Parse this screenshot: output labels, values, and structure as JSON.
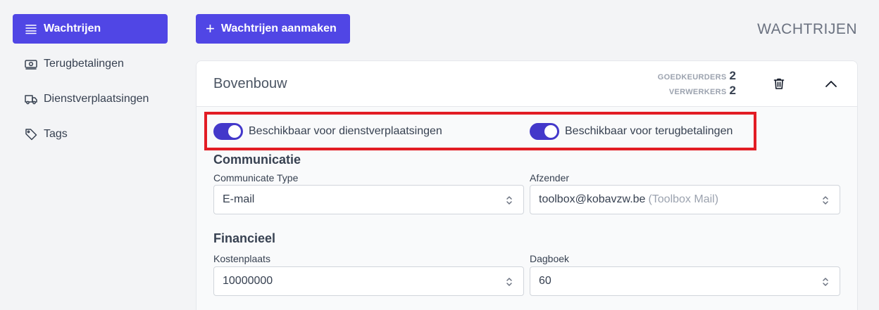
{
  "sidebar": {
    "items": [
      {
        "label": "Wachtrijen",
        "icon": "queue-list-icon",
        "active": true
      },
      {
        "label": "Terugbetalingen",
        "icon": "banknote-icon",
        "active": false
      },
      {
        "label": "Dienstverplaatsingen",
        "icon": "truck-icon",
        "active": false
      },
      {
        "label": "Tags",
        "icon": "tag-icon",
        "active": false
      }
    ]
  },
  "toolbar": {
    "create_label": "Wachtrijen aanmaken",
    "create_icon": "plus-icon",
    "page_title": "WACHTRIJEN"
  },
  "queue": {
    "title": "Bovenbouw",
    "approvers_label": "GOEDKEURDERS",
    "approvers_count": "2",
    "processors_label": "VERWERKERS",
    "processors_count": "2",
    "delete_icon": "trash-icon",
    "collapse_icon": "chevron-up-icon",
    "toggles": {
      "service_moves": {
        "label": "Beschikbaar voor dienstverplaatsingen",
        "on": true
      },
      "refunds": {
        "label": "Beschikbaar voor terugbetalingen",
        "on": true
      }
    },
    "communication": {
      "title": "Communicatie",
      "type_label": "Communicate Type",
      "type_value": "E-mail",
      "sender_label": "Afzender",
      "sender_value": "toolbox@kobavzw.be",
      "sender_hint": "(Toolbox Mail)"
    },
    "financial": {
      "title": "Financieel",
      "cost_center_label": "Kostenplaats",
      "cost_center_value": "10000000",
      "journal_label": "Dagboek",
      "journal_value": "60"
    }
  },
  "colors": {
    "accent": "#5046e5",
    "toggle_on": "#4338ca",
    "highlight": "#e21c24"
  }
}
